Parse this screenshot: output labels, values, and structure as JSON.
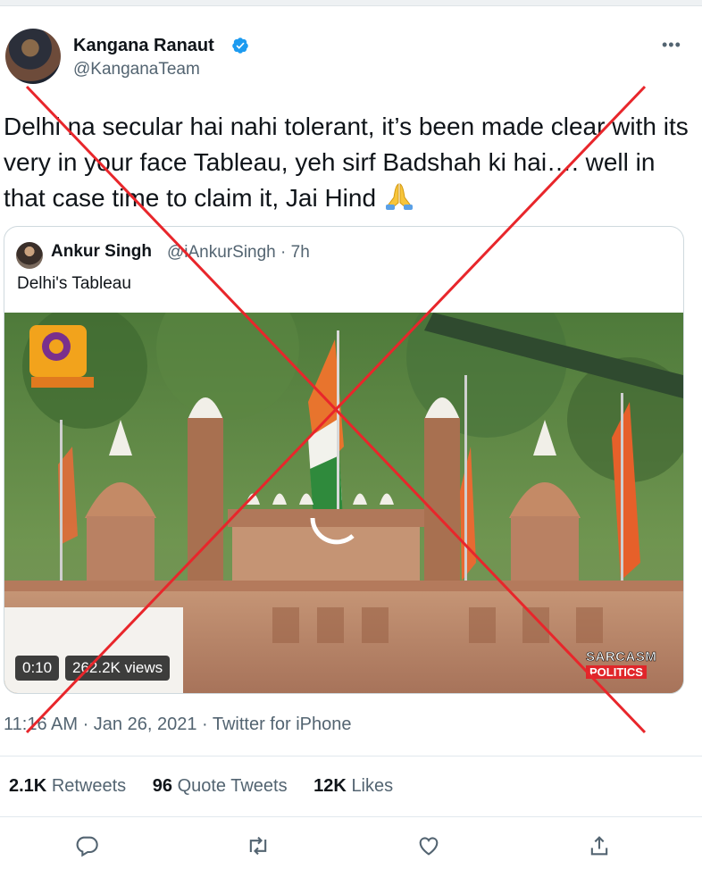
{
  "tweet": {
    "author_name": "Kangana Ranaut",
    "author_handle": "@KanganaTeam",
    "text": "Delhi na secular hai nahi tolerant, it’s been made clear with its very in your face Tableau, yeh sirf Badshah ki hai…. well in that case time to claim it, Jai Hind",
    "emoji": "folded-hands",
    "timestamp": "11:16 AM · Jan 26, 2021 · Twitter for iPhone"
  },
  "quote": {
    "author_name": "Ankur Singh",
    "meta": "@iAnkurSingh · 7h",
    "text": "Delhi's Tableau",
    "video": {
      "duration": "0:10",
      "views": "262.2K views",
      "watermark_top": "SARCASM",
      "watermark_bottom": "POLITICS"
    }
  },
  "stats": {
    "retweets_count": "2.1K",
    "retweets_label": "Retweets",
    "quotes_count": "96",
    "quotes_label": "Quote Tweets",
    "likes_count": "12K",
    "likes_label": "Likes"
  },
  "icons": {
    "verified": "verified-badge-icon",
    "more": "more-icon",
    "reply": "reply-icon",
    "retweet": "retweet-icon",
    "like": "heart-icon",
    "share": "share-icon"
  },
  "colors": {
    "verified_blue": "#1d9bf0",
    "cross_red": "#e8262b",
    "muted_text": "#536471"
  }
}
